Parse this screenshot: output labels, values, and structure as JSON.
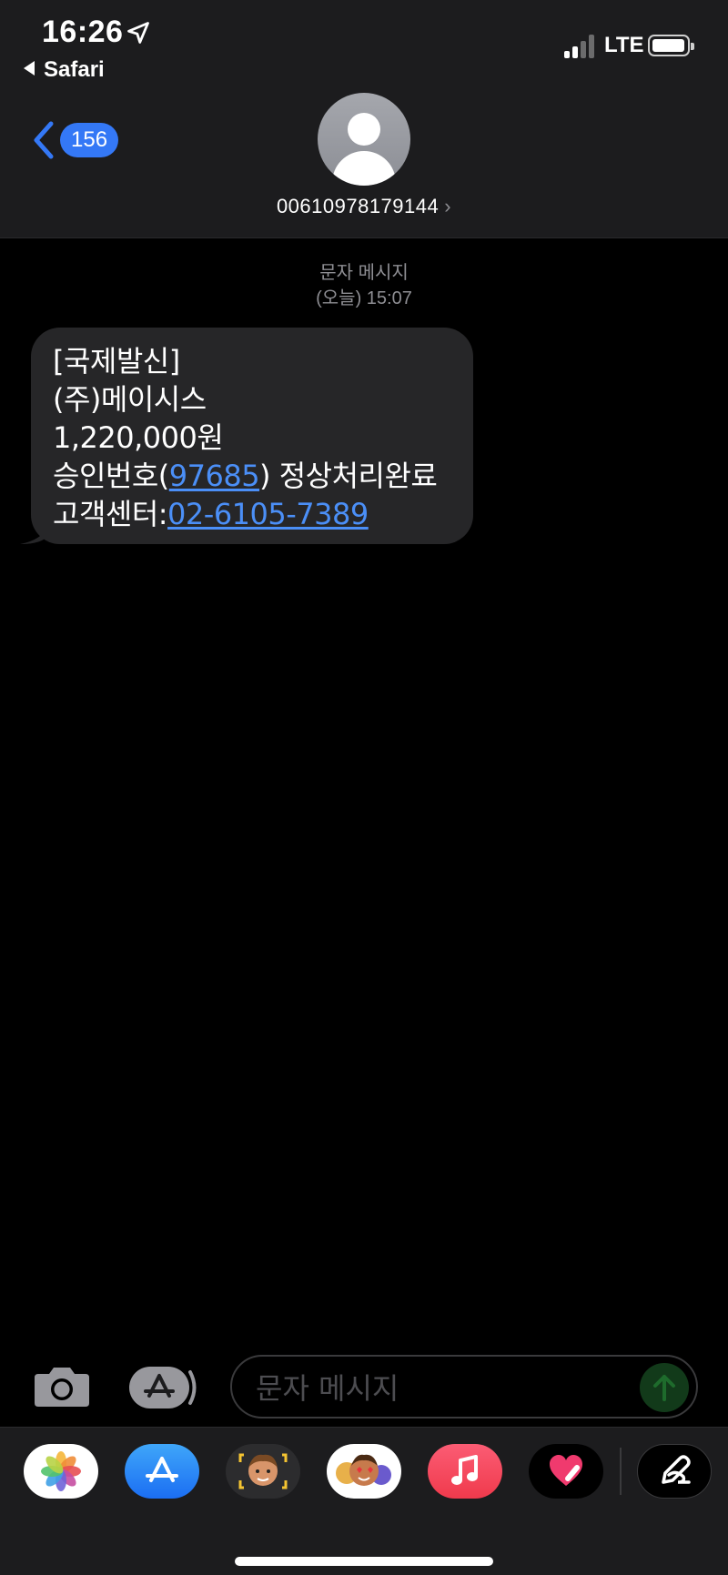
{
  "status_bar": {
    "time": "16:26",
    "back_app": "Safari",
    "network": "LTE"
  },
  "nav": {
    "unread_count": "156",
    "contact_number": "00610978179144",
    "contact_chevron": "›"
  },
  "thread": {
    "meta_line1": "문자 메시지",
    "meta_line2": "(오늘) 15:07",
    "message": {
      "line1": "[국제발신]",
      "line2": "(주)메이시스",
      "line3": "1,220,000원",
      "line4_prefix": "승인번호(",
      "line4_link": "97685",
      "line4_suffix": ") 정상처리완료",
      "line5_prefix": "고객센터:",
      "line5_link": "02-6105-7389"
    }
  },
  "composer": {
    "placeholder": "문자 메시지"
  },
  "app_drawer": {
    "apps": [
      "photos-icon",
      "app-store-icon",
      "memoji-icon",
      "animoji-stickers-icon",
      "music-icon",
      "digital-touch-icon",
      "more-apps-icon"
    ]
  },
  "colors": {
    "accent": "#3478f6",
    "link": "#4b8ff7",
    "bubble": "#262628",
    "header": "#1c1c1e"
  }
}
